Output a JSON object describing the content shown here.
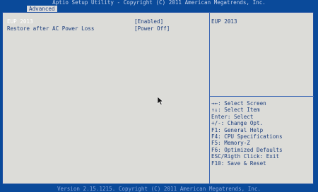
{
  "header": {
    "title": "Aptio Setup Utility - Copyright (C) 2011 American Megatrends, Inc.",
    "tab": "Advanced"
  },
  "settings": [
    {
      "label": "EUP 2013",
      "value": "[Enabled]"
    },
    {
      "label": "Restore after AC Power Loss",
      "value": "[Power Off]"
    }
  ],
  "help": {
    "text": "EUP 2013"
  },
  "legend": [
    "→←: Select Screen",
    "↑↓: Select Item",
    "Enter: Select",
    "+/-: Change Opt.",
    "F1: General Help",
    "F4: CPU Specifications",
    "F5: Memory-Z",
    "F6: Optimized Defaults",
    "ESC/Rigth Click: Exit",
    "F10: Save & Reset"
  ],
  "footer": {
    "version": "Version 2.15.1215. Copyright (C) 2011 American Megatrends, Inc."
  },
  "colors": {
    "background": "#0a4a9a",
    "panel": "#dcdcd8",
    "text": "#1e3f7e",
    "selected_text": "#ffffff"
  }
}
